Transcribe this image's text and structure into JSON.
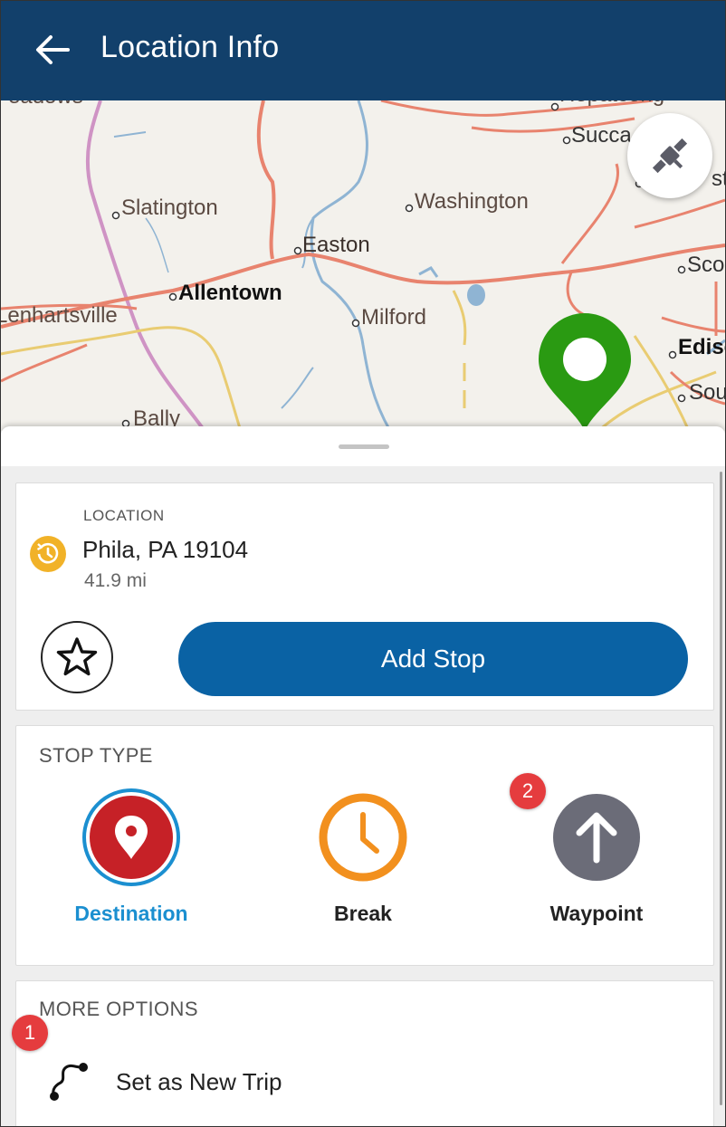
{
  "header": {
    "title": "Location Info"
  },
  "map": {
    "labels": {
      "meadows": "eadows",
      "hopatcong": "Hopatcong",
      "succasunna": "Succa",
      "slatington": "Slatington",
      "washington": "Washington",
      "easton": "Easton",
      "allentown": "Allentown",
      "lenhartsville": "Lenhartsville",
      "milford": "Milford",
      "scotch": "Sco",
      "edison": "Ediso",
      "south": "Sou",
      "stow": "sto",
      "bally": "Bally"
    }
  },
  "location": {
    "label": "LOCATION",
    "name": "Phila, PA 19104",
    "distance": "41.9 mi",
    "add_stop_label": "Add Stop"
  },
  "stop_type": {
    "title": "STOP TYPE",
    "options": [
      {
        "label": "Destination",
        "selected": true
      },
      {
        "label": "Break",
        "selected": false
      },
      {
        "label": "Waypoint",
        "selected": false
      }
    ]
  },
  "more_options": {
    "title": "MORE OPTIONS",
    "new_trip_label": "Set as New Trip"
  },
  "badges": {
    "one": "1",
    "two": "2"
  },
  "colors": {
    "header": "#12406b",
    "add_stop": "#0a62a4",
    "destination_red": "#c62127",
    "destination_ring": "#1b8fd0",
    "break_orange": "#f2901e",
    "waypoint_gray": "#6b6c78",
    "pin_green": "#2a9a12",
    "badge_red": "#e53c3e"
  }
}
